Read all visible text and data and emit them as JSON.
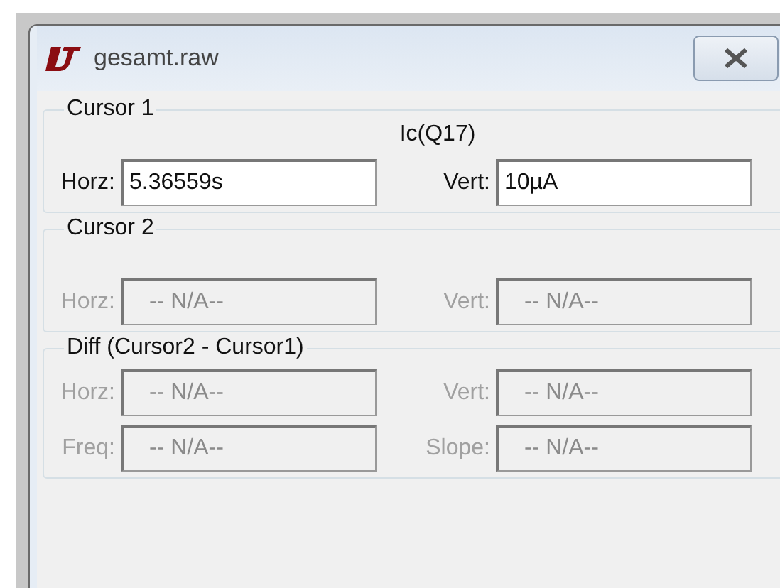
{
  "window": {
    "title": "gesamt.raw"
  },
  "groups": [
    {
      "kind": "cursor",
      "label": "Cursor 1",
      "trace": "Ic(Q17)",
      "rows": [
        [
          {
            "label": "Horz:",
            "value": "5.36559s",
            "disabled": false
          },
          {
            "label": "Vert:",
            "value": "10µA",
            "disabled": false
          }
        ]
      ]
    },
    {
      "kind": "cursor",
      "label": "Cursor 2",
      "rows": [
        [
          {
            "label": "Horz:",
            "value": "-- N/A--",
            "disabled": true
          },
          {
            "label": "Vert:",
            "value": "-- N/A--",
            "disabled": true
          }
        ]
      ]
    },
    {
      "kind": "diff",
      "label": "Diff (Cursor2 - Cursor1)",
      "rows": [
        [
          {
            "label": "Horz:",
            "value": "-- N/A--",
            "disabled": true
          },
          {
            "label": "Vert:",
            "value": "-- N/A--",
            "disabled": true
          }
        ],
        [
          {
            "label": "Freq:",
            "value": "-- N/A--",
            "disabled": true
          },
          {
            "label": "Slope:",
            "value": "-- N/A--",
            "disabled": true
          }
        ]
      ]
    }
  ]
}
